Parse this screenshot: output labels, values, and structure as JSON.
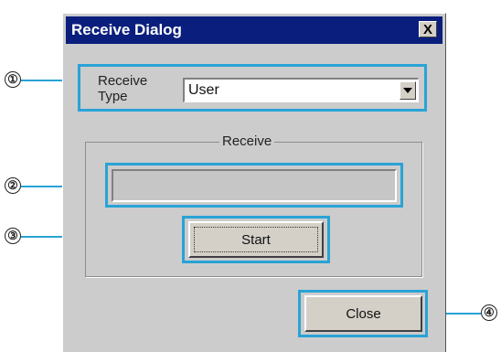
{
  "dialog": {
    "title": "Receive Dialog",
    "close_glyph": "X",
    "receive_type_label": "Receive\nType",
    "receive_type_value": "User",
    "group_title": "Receive",
    "start_label": "Start",
    "close_label": "Close"
  },
  "callouts": [
    "①",
    "②",
    "③",
    "④"
  ],
  "colors": {
    "highlight": "#29a3d6",
    "titlebar": "#0a1e7d",
    "dialog_bg": "#cccccc"
  }
}
